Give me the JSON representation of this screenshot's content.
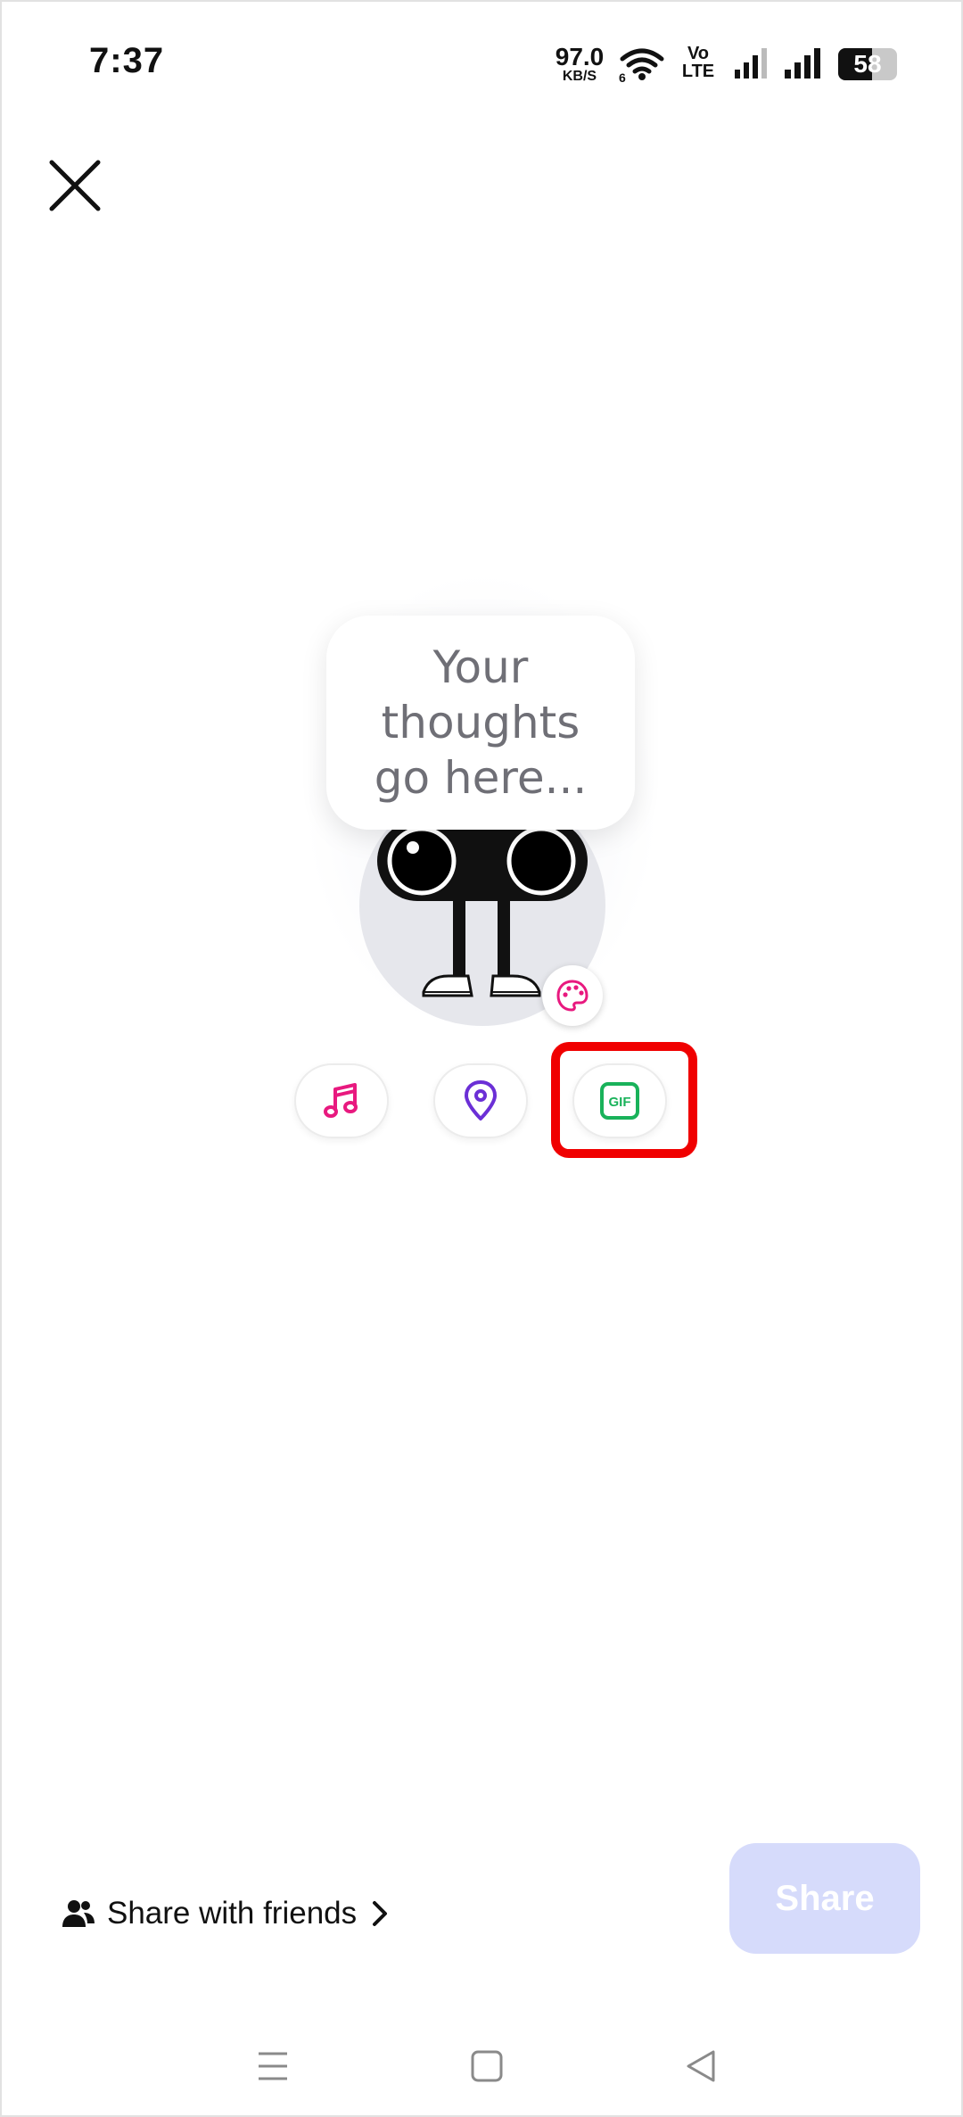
{
  "status_bar": {
    "time": "7:37",
    "net_speed_value": "97.0",
    "net_speed_unit": "KB/S",
    "wifi_badge": "6",
    "volte_top": "Vo",
    "volte_bottom": "LTE",
    "battery_level": "58",
    "battery_fraction": 0.58
  },
  "bubble": {
    "placeholder": "Your thoughts go here..."
  },
  "actions": {
    "music_icon": "music-note-icon",
    "location_icon": "map-pin-icon",
    "gif_label": "GIF"
  },
  "bottom": {
    "share_with_friends": "Share with friends",
    "share_button": "Share"
  },
  "colors": {
    "music_accent": "#e8197f",
    "location_accent": "#6b2fd6",
    "gif_accent": "#19b25a",
    "highlight": "#f00000",
    "share_button_bg": "#d6dbfb"
  }
}
